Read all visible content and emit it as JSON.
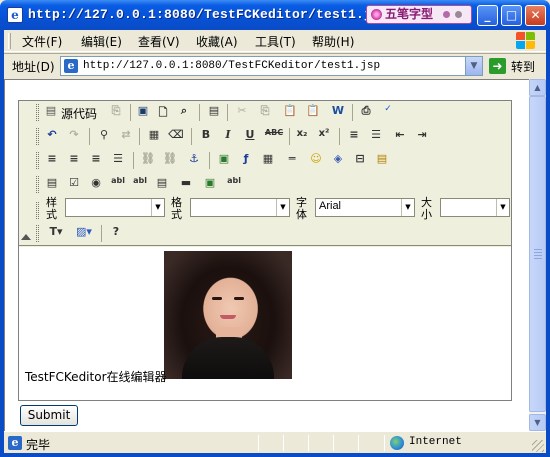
{
  "window": {
    "title": "http://127.0.0.1:8080/TestFCKeditor/test1.js",
    "ime_label": "五笔字型",
    "buttons": {
      "minimize": "_",
      "maximize": "□",
      "close": "✕"
    }
  },
  "menu": {
    "items": [
      "文件(F)",
      "编辑(E)",
      "查看(V)",
      "收藏(A)",
      "工具(T)",
      "帮助(H)"
    ]
  },
  "address_bar": {
    "label": "地址(D)",
    "url": "http://127.0.0.1:8080/TestFCKeditor/test1.jsp",
    "go_label": "转到"
  },
  "editor": {
    "source_label": "源代码",
    "toolbar_row2": [
      "B",
      "I",
      "U",
      "ABC",
      "x₂",
      "x²"
    ],
    "style_label": "样式",
    "style_value": "",
    "format_label": "格式",
    "format_value": "",
    "font_label": "字体",
    "font_value": "Arial",
    "size_label": "大小",
    "size_value": "",
    "content_text": "TestFCKeditor在线编辑器"
  },
  "form": {
    "submit_label": "Submit"
  },
  "status_bar": {
    "text": "完毕",
    "zone": "Internet"
  },
  "colors": {
    "title_bar": "#0653d8",
    "chrome": "#ece9d8",
    "editor_toolbar": "#efefde"
  }
}
